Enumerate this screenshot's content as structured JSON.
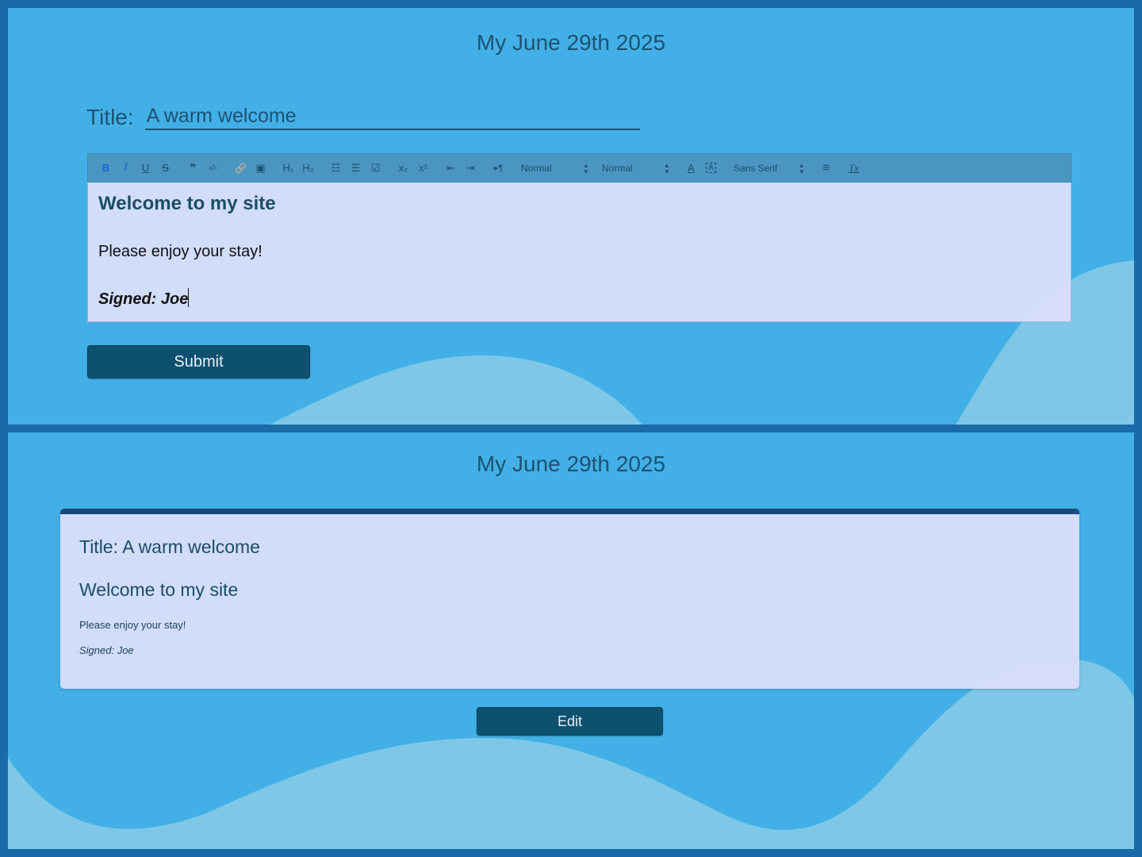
{
  "app_title": "My June 29th 2025",
  "editor_view": {
    "title_label": "Title:",
    "title_value": "A warm welcome",
    "toolbar": {
      "bold": "B",
      "italic": "I",
      "underline": "U",
      "strike": "S",
      "blockquote": "❞",
      "code": "‹/›",
      "link": "🔗",
      "image": "▣",
      "h1": "H₁",
      "h2": "H₂",
      "ordered_list": "☷",
      "bullet_list": "☰",
      "check_list": "☑",
      "subscript": "x₂",
      "superscript": "x²",
      "outdent": "⇤",
      "indent": "⇥",
      "direction": "▸¶",
      "size_select": "Normal",
      "header_select": "Normal",
      "text_color": "A",
      "background_color": "A",
      "font_select": "Sans Serif",
      "align": "≡",
      "clean": "Tx"
    },
    "content": {
      "heading": "Welcome to my site",
      "paragraph": "Please enjoy your stay!",
      "signature": "Signed: Joe"
    },
    "submit_label": "Submit"
  },
  "preview_view": {
    "title_line": "Title: A warm welcome",
    "heading": "Welcome to my site",
    "paragraph": "Please enjoy your stay!",
    "signature": "Signed: Joe",
    "edit_label": "Edit"
  },
  "colors": {
    "background": "#1a6aa8",
    "panel": "#42b0e6",
    "wave": "#7ec7e6",
    "accent": "#0d5070",
    "card": "#dadefc"
  }
}
